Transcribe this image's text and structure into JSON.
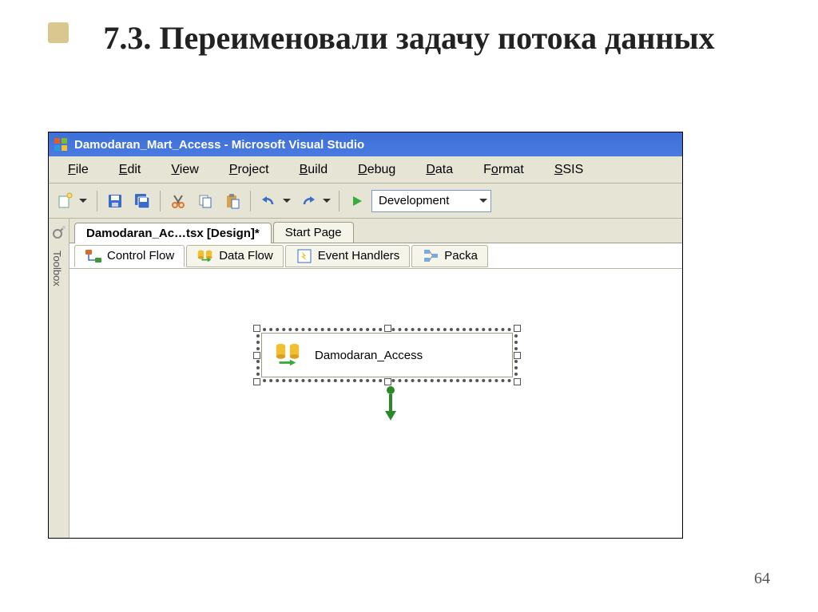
{
  "slide": {
    "title": "7.3. Переименовали задачу потока данных",
    "page_number": "64"
  },
  "vs": {
    "titlebar": "Damodaran_Mart_Access - Microsoft Visual Studio",
    "menu": {
      "file": "File",
      "edit": "Edit",
      "view": "View",
      "project": "Project",
      "build": "Build",
      "debug": "Debug",
      "data": "Data",
      "format": "Format",
      "ssis": "SSIS"
    },
    "toolbar": {
      "config": "Development"
    },
    "toolbox_label": "Toolbox",
    "doc_tabs": {
      "active": "Damodaran_Ac…tsx [Design]*",
      "start": "Start Page"
    },
    "designer_tabs": {
      "control_flow": "Control Flow",
      "data_flow": "Data Flow",
      "event_handlers": "Event Handlers",
      "package": "Packa"
    },
    "task": {
      "name": "Damodaran_Access"
    }
  }
}
